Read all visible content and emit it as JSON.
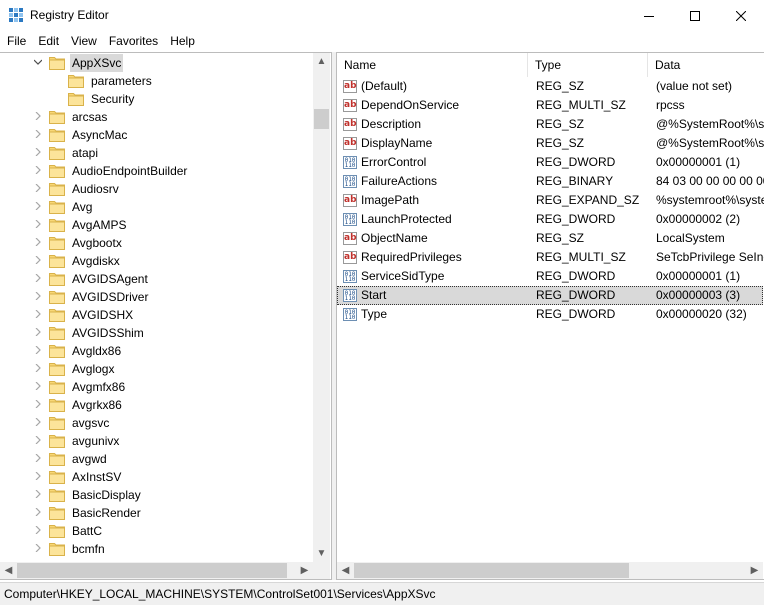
{
  "window": {
    "title": "Registry Editor"
  },
  "menu": [
    "File",
    "Edit",
    "View",
    "Favorites",
    "Help"
  ],
  "tree": {
    "selected": "AppXSvc",
    "children": [
      "parameters",
      "Security"
    ],
    "items": [
      "arcsas",
      "AsyncMac",
      "atapi",
      "AudioEndpointBuilder",
      "Audiosrv",
      "Avg",
      "AvgAMPS",
      "Avgbootx",
      "Avgdiskx",
      "AVGIDSAgent",
      "AVGIDSDriver",
      "AVGIDSHX",
      "AVGIDSShim",
      "Avgldx86",
      "Avglogx",
      "Avgmfx86",
      "Avgrkx86",
      "avgsvc",
      "avgunivx",
      "avgwd",
      "AxInstSV",
      "BasicDisplay",
      "BasicRender",
      "BattC",
      "bcmfn"
    ]
  },
  "columns": {
    "name": "Name",
    "type": "Type",
    "data": "Data"
  },
  "values": [
    {
      "name": "(Default)",
      "type": "REG_SZ",
      "data": "(value not set)",
      "icon": "string-value-icon"
    },
    {
      "name": "DependOnService",
      "type": "REG_MULTI_SZ",
      "data": "rpcss",
      "icon": "string-value-icon"
    },
    {
      "name": "Description",
      "type": "REG_SZ",
      "data": "@%SystemRoot%\\sy",
      "icon": "string-value-icon"
    },
    {
      "name": "DisplayName",
      "type": "REG_SZ",
      "data": "@%SystemRoot%\\sy",
      "icon": "string-value-icon"
    },
    {
      "name": "ErrorControl",
      "type": "REG_DWORD",
      "data": "0x00000001 (1)",
      "icon": "binary-value-icon"
    },
    {
      "name": "FailureActions",
      "type": "REG_BINARY",
      "data": "84 03 00 00 00 00 00 0",
      "icon": "binary-value-icon"
    },
    {
      "name": "ImagePath",
      "type": "REG_EXPAND_SZ",
      "data": "%systemroot%\\syste",
      "icon": "string-value-icon"
    },
    {
      "name": "LaunchProtected",
      "type": "REG_DWORD",
      "data": "0x00000002 (2)",
      "icon": "binary-value-icon"
    },
    {
      "name": "ObjectName",
      "type": "REG_SZ",
      "data": "LocalSystem",
      "icon": "string-value-icon"
    },
    {
      "name": "RequiredPrivileges",
      "type": "REG_MULTI_SZ",
      "data": "SeTcbPrivilege SeInc",
      "icon": "string-value-icon"
    },
    {
      "name": "ServiceSidType",
      "type": "REG_DWORD",
      "data": "0x00000001 (1)",
      "icon": "binary-value-icon"
    },
    {
      "name": "Start",
      "type": "REG_DWORD",
      "data": "0x00000003 (3)",
      "icon": "binary-value-icon",
      "selected": true
    },
    {
      "name": "Type",
      "type": "REG_DWORD",
      "data": "0x00000020 (32)",
      "icon": "binary-value-icon"
    }
  ],
  "status": {
    "path": "Computer\\HKEY_LOCAL_MACHINE\\SYSTEM\\ControlSet001\\Services\\AppXSvc"
  }
}
